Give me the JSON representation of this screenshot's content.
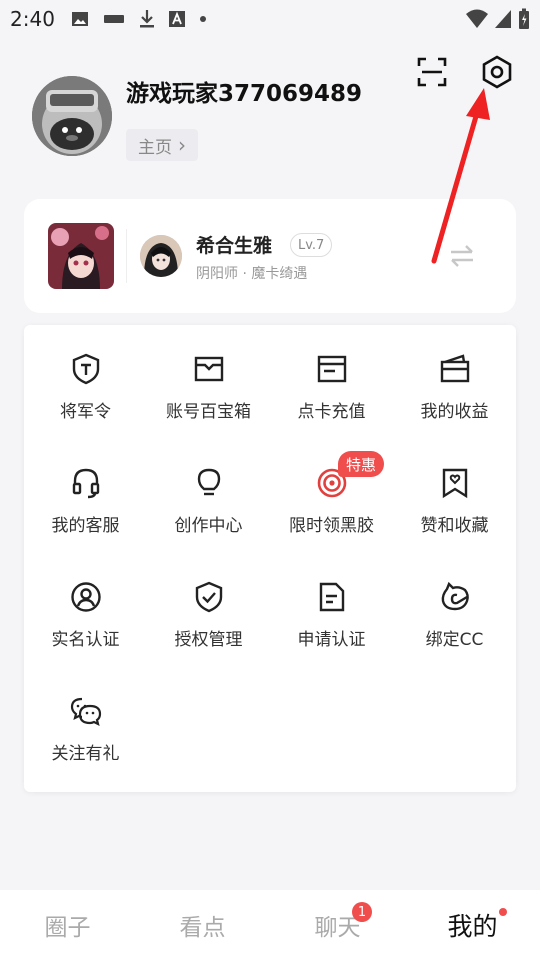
{
  "status_bar": {
    "time": "2:40",
    "icons": [
      "image-icon",
      "app-icon",
      "download-icon",
      "a-icon",
      "dot-icon",
      "wifi-icon",
      "signal-icon",
      "battery-icon"
    ]
  },
  "header": {
    "icons": [
      "scan-icon",
      "settings-icon"
    ]
  },
  "profile": {
    "username": "游戏玩家377069489",
    "home_label": "主页",
    "home_arrow": "›"
  },
  "game_card": {
    "character_name": "希合生雅",
    "level": "Lv.7",
    "subtitle": "阴阳师 · 魔卡绮遇",
    "switch_icon": "swap-icon"
  },
  "grid": {
    "items": [
      {
        "label": "将军令",
        "icon": "shield-t-icon"
      },
      {
        "label": "账号百宝箱",
        "icon": "treasure-box-icon"
      },
      {
        "label": "点卡充值",
        "icon": "card-icon"
      },
      {
        "label": "我的收益",
        "icon": "wallet-icon"
      },
      {
        "label": "我的客服",
        "icon": "headset-icon"
      },
      {
        "label": "创作中心",
        "icon": "lightbulb-icon"
      },
      {
        "label": "限时领黑胶",
        "icon": "vinyl-icon"
      },
      {
        "label": "赞和收藏",
        "icon": "bookmark-heart-icon"
      },
      {
        "label": "实名认证",
        "icon": "user-circle-icon"
      },
      {
        "label": "授权管理",
        "icon": "shield-check-icon"
      },
      {
        "label": "申请认证",
        "icon": "document-icon"
      },
      {
        "label": "绑定CC",
        "icon": "cc-icon"
      },
      {
        "label": "关注有礼",
        "icon": "wechat-icon"
      }
    ],
    "promo_badge": "特惠"
  },
  "bottom_nav": {
    "items": [
      {
        "label": "圈子"
      },
      {
        "label": "看点"
      },
      {
        "label": "聊天"
      },
      {
        "label": "我的"
      }
    ],
    "chat_badge": "1",
    "active": "我的"
  },
  "colors": {
    "accent_red": "#f04d4d",
    "background": "#f5f5f7",
    "card": "#ffffff"
  }
}
